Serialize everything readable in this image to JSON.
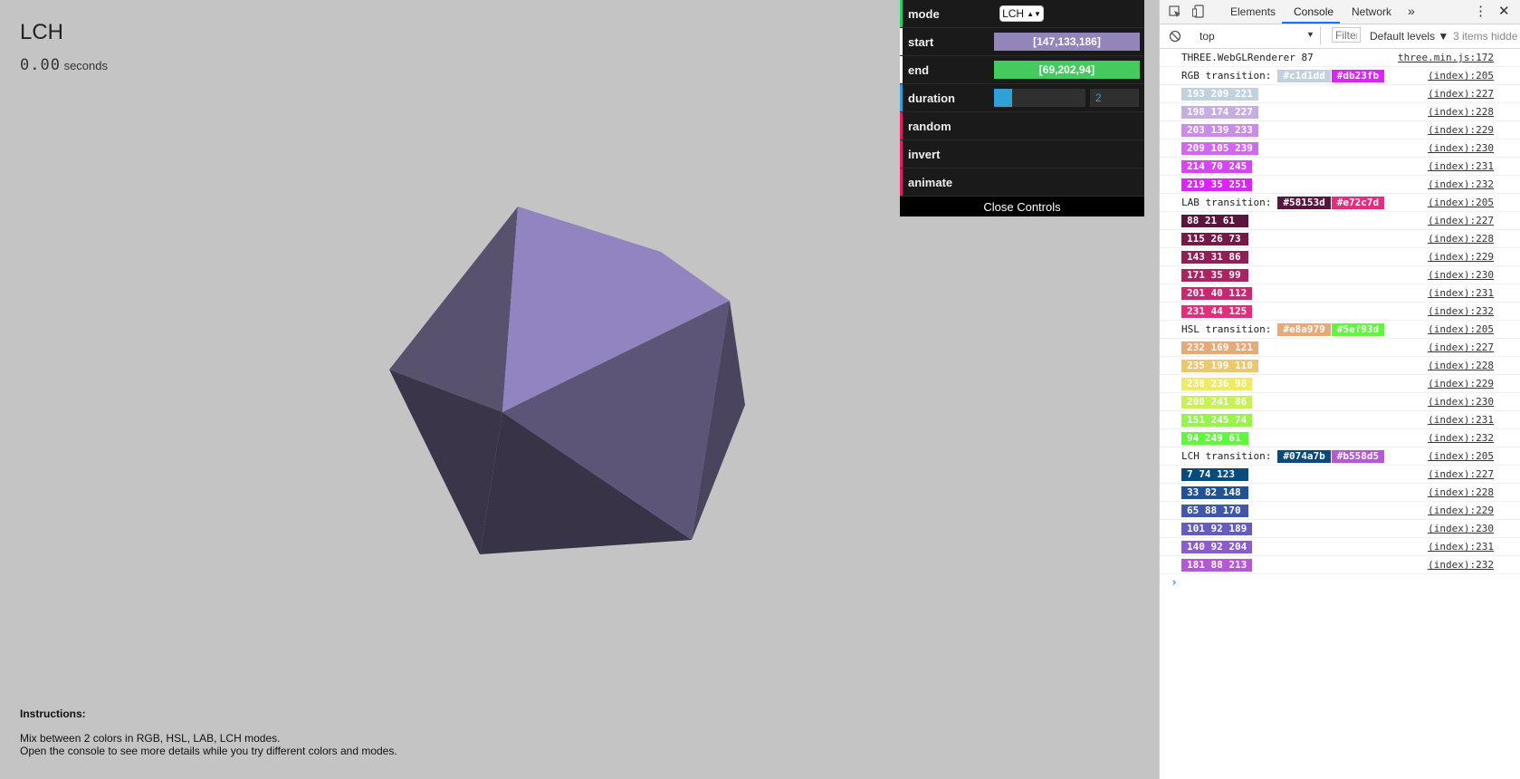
{
  "app": {
    "title": "LCH",
    "time_value": "0.00",
    "time_unit": "seconds",
    "instructions_heading": "Instructions:",
    "instructions_line1": "Mix between 2 colors in RGB, HSL, LAB, LCH modes.",
    "instructions_line2": "Open the console to see more details while you try different colors and modes."
  },
  "gui": {
    "rows": [
      {
        "label": "mode",
        "bar_color": "#1ed36f",
        "value": "LCH"
      },
      {
        "label": "start",
        "bar_color": "#ffffff",
        "value": "[147,133,186]",
        "swatch": "#9385ba"
      },
      {
        "label": "end",
        "bar_color": "#ffffff",
        "value": "[69,202,94]",
        "swatch": "#45ca5e"
      },
      {
        "label": "duration",
        "bar_color": "#2fa1d6",
        "value": "2",
        "slider_fraction": 0.2
      },
      {
        "label": "random",
        "bar_color": "#e61d5f"
      },
      {
        "label": "invert",
        "bar_color": "#e61d5f"
      },
      {
        "label": "animate",
        "bar_color": "#e61d5f"
      }
    ],
    "close_label": "Close Controls"
  },
  "devtools": {
    "tabs": [
      "Elements",
      "Console",
      "Network"
    ],
    "active_tab": "Console",
    "more_tabs": "»",
    "context": "top",
    "filter_placeholder": "Filter",
    "levels": "Default levels ▼",
    "hidden_count": "3 items hidde",
    "logs": [
      {
        "text": "THREE.WebGLRenderer 87",
        "src": "three.min.js:172"
      },
      {
        "text": "RGB transition:",
        "chips": [
          {
            "label": "#c1d1dd",
            "color": "#c1d1dd"
          },
          {
            "label": "#db23fb",
            "color": "#db23fb"
          }
        ],
        "src": "(index):205"
      },
      {
        "chip": {
          "label": "193 209 221",
          "color": "#c1d1dd"
        },
        "src": "(index):227"
      },
      {
        "chip": {
          "label": "198 174 227",
          "color": "#c6aee3"
        },
        "src": "(index):228"
      },
      {
        "chip": {
          "label": "203 139 233",
          "color": "#cb8be9"
        },
        "src": "(index):229"
      },
      {
        "chip": {
          "label": "209 105 239",
          "color": "#d169ef"
        },
        "src": "(index):230"
      },
      {
        "chip": {
          "label": "214 70 245",
          "color": "#d646f5"
        },
        "src": "(index):231"
      },
      {
        "chip": {
          "label": "219 35 251",
          "color": "#db23fb"
        },
        "src": "(index):232"
      },
      {
        "text": "LAB transition:",
        "chips": [
          {
            "label": "#58153d",
            "color": "#58153d"
          },
          {
            "label": "#e72c7d",
            "color": "#e72c7d"
          }
        ],
        "src": "(index):205"
      },
      {
        "chip": {
          "label": "88 21 61",
          "color": "#58153d"
        },
        "src": "(index):227"
      },
      {
        "chip": {
          "label": "115 26 73",
          "color": "#731a49"
        },
        "src": "(index):228"
      },
      {
        "chip": {
          "label": "143 31 86",
          "color": "#8f1f56"
        },
        "src": "(index):229"
      },
      {
        "chip": {
          "label": "171 35 99",
          "color": "#ab2363"
        },
        "src": "(index):230"
      },
      {
        "chip": {
          "label": "201 40 112",
          "color": "#c92870"
        },
        "src": "(index):231"
      },
      {
        "chip": {
          "label": "231 44 125",
          "color": "#e72c7d"
        },
        "src": "(index):232"
      },
      {
        "text": "HSL transition:",
        "chips": [
          {
            "label": "#e8a979",
            "color": "#e8a979"
          },
          {
            "label": "#5ef93d",
            "color": "#5ef93d"
          }
        ],
        "src": "(index):205"
      },
      {
        "chip": {
          "label": "232 169 121",
          "color": "#e8a979"
        },
        "src": "(index):227"
      },
      {
        "chip": {
          "label": "235 199 110",
          "color": "#ebc76e"
        },
        "src": "(index):228"
      },
      {
        "chip": {
          "label": "238 236 98",
          "color": "#eeec62"
        },
        "src": "(index):229"
      },
      {
        "chip": {
          "label": "200 241 86",
          "color": "#c8f156"
        },
        "src": "(index):230"
      },
      {
        "chip": {
          "label": "151 245 74",
          "color": "#97f54a"
        },
        "src": "(index):231"
      },
      {
        "chip": {
          "label": "94 249 61",
          "color": "#5ef93d"
        },
        "src": "(index):232"
      },
      {
        "text": "LCH transition:",
        "chips": [
          {
            "label": "#074a7b",
            "color": "#074a7b"
          },
          {
            "label": "#b558d5",
            "color": "#b558d5"
          }
        ],
        "src": "(index):205"
      },
      {
        "chip": {
          "label": "7 74 123",
          "color": "#074a7b"
        },
        "src": "(index):227"
      },
      {
        "chip": {
          "label": "33 82 148",
          "color": "#215294"
        },
        "src": "(index):228"
      },
      {
        "chip": {
          "label": "65 88 170",
          "color": "#4158aa"
        },
        "src": "(index):229"
      },
      {
        "chip": {
          "label": "101 92 189",
          "color": "#655cbd"
        },
        "src": "(index):230"
      },
      {
        "chip": {
          "label": "140 92 204",
          "color": "#8c5ccc"
        },
        "src": "(index):231"
      },
      {
        "chip": {
          "label": "181 88 213",
          "color": "#b558d5"
        },
        "src": "(index):232"
      }
    ],
    "prompt": "›"
  }
}
